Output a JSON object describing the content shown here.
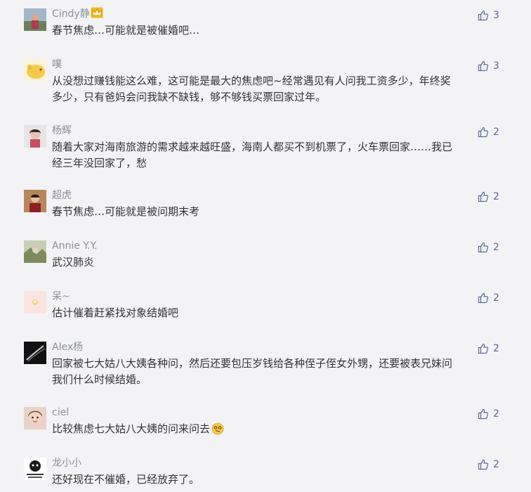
{
  "comments": [
    {
      "name": "Cindy静",
      "text": [
        "春节焦虑…可能就是被催婚吧…"
      ],
      "likes": "3"
    },
    {
      "name": "噗",
      "text": [
        "从没想过赚钱能这么难，这可能是最大的焦虑吧~经常遇见有人问我工资多少，年终奖",
        "多少，只有爸妈会问我缺不缺钱，够不够钱买票回家过年。"
      ],
      "likes": "3"
    },
    {
      "name": "杨辉",
      "text": [
        "随着大家对海南旅游的需求越来越旺盛，海南人都买不到机票了，火车票回家……我已",
        "经三年没回家了，愁"
      ],
      "likes": "2"
    },
    {
      "name": "超虎",
      "text": [
        "春节焦虑…可能就是被问期末考"
      ],
      "likes": "2"
    },
    {
      "name": "Annie  Y.Y.",
      "text": [
        "武汉肺炎"
      ],
      "likes": "2"
    },
    {
      "name": "呆~",
      "text": [
        "估计催着赶紧找对象结婚吧"
      ],
      "likes": "2"
    },
    {
      "name": "Alex杨",
      "text": [
        "回家被七大姑八大姨各种问，然后还要包压岁钱给各种侄子侄女外甥，还要被表兄妹问",
        "我们什么时候结婚。"
      ],
      "likes": "2"
    },
    {
      "name": "ciel",
      "text": [
        "比较焦虑七大姑八大姨的问来问去"
      ],
      "likes": "2"
    },
    {
      "name": "龙小小",
      "text": [
        "还好现在不催婚，已经放弃了。"
      ],
      "likes": "2"
    }
  ],
  "icons": {
    "like": "thumbs-up-icon",
    "crown": "crown-icon",
    "emoji": "woozy-face-emoji-icon"
  },
  "colors": {
    "background": "#f3f3f5",
    "name": "#8a8f99",
    "text": "#333333",
    "like": "#576b95"
  }
}
